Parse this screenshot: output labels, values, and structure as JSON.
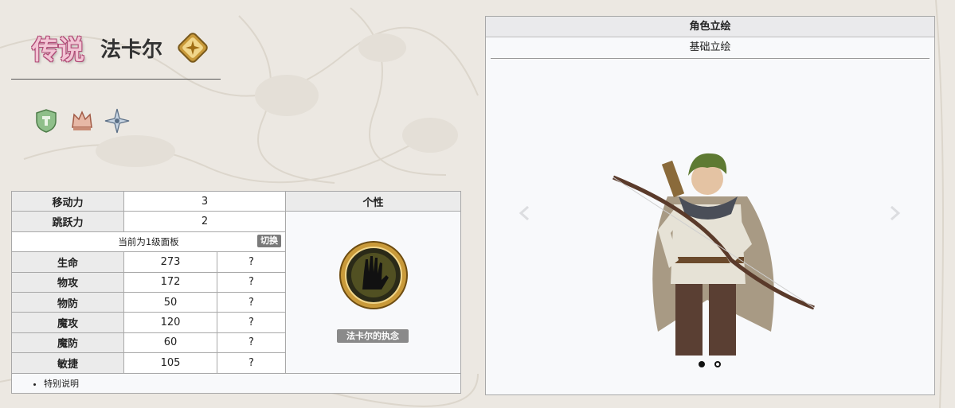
{
  "header": {
    "rarity": "传说",
    "character_name": "法卡尔"
  },
  "stats": {
    "move_label": "移动力",
    "move_value": "3",
    "jump_label": "跳跃力",
    "jump_value": "2",
    "panel_note": "当前为1级面板",
    "toggle_label": "切换",
    "personality_header": "个性",
    "rows": [
      {
        "label": "生命",
        "value": "273",
        "extra": "?"
      },
      {
        "label": "物攻",
        "value": "172",
        "extra": "?"
      },
      {
        "label": "物防",
        "value": "50",
        "extra": "?"
      },
      {
        "label": "魔攻",
        "value": "120",
        "extra": "?"
      },
      {
        "label": "魔防",
        "value": "60",
        "extra": "?"
      },
      {
        "label": "敏捷",
        "value": "105",
        "extra": "?"
      }
    ],
    "personality_skill": "法卡尔的执念",
    "note": "特别说明"
  },
  "portrait": {
    "title": "角色立绘",
    "tab": "基础立绘",
    "slides_total": 2,
    "active_slide": 1
  },
  "colors": {
    "background": "#ece8e2",
    "rarity_pink": "#f2c4d4",
    "table_header": "#ebebeb",
    "toggle_gray": "#7a7a7a"
  },
  "icons": [
    "diamond-class-icon",
    "shield-trait-icon",
    "crown-trait-icon",
    "star-trait-icon",
    "grasping-hand-skill-icon",
    "chevron-left-icon",
    "chevron-right-icon"
  ]
}
